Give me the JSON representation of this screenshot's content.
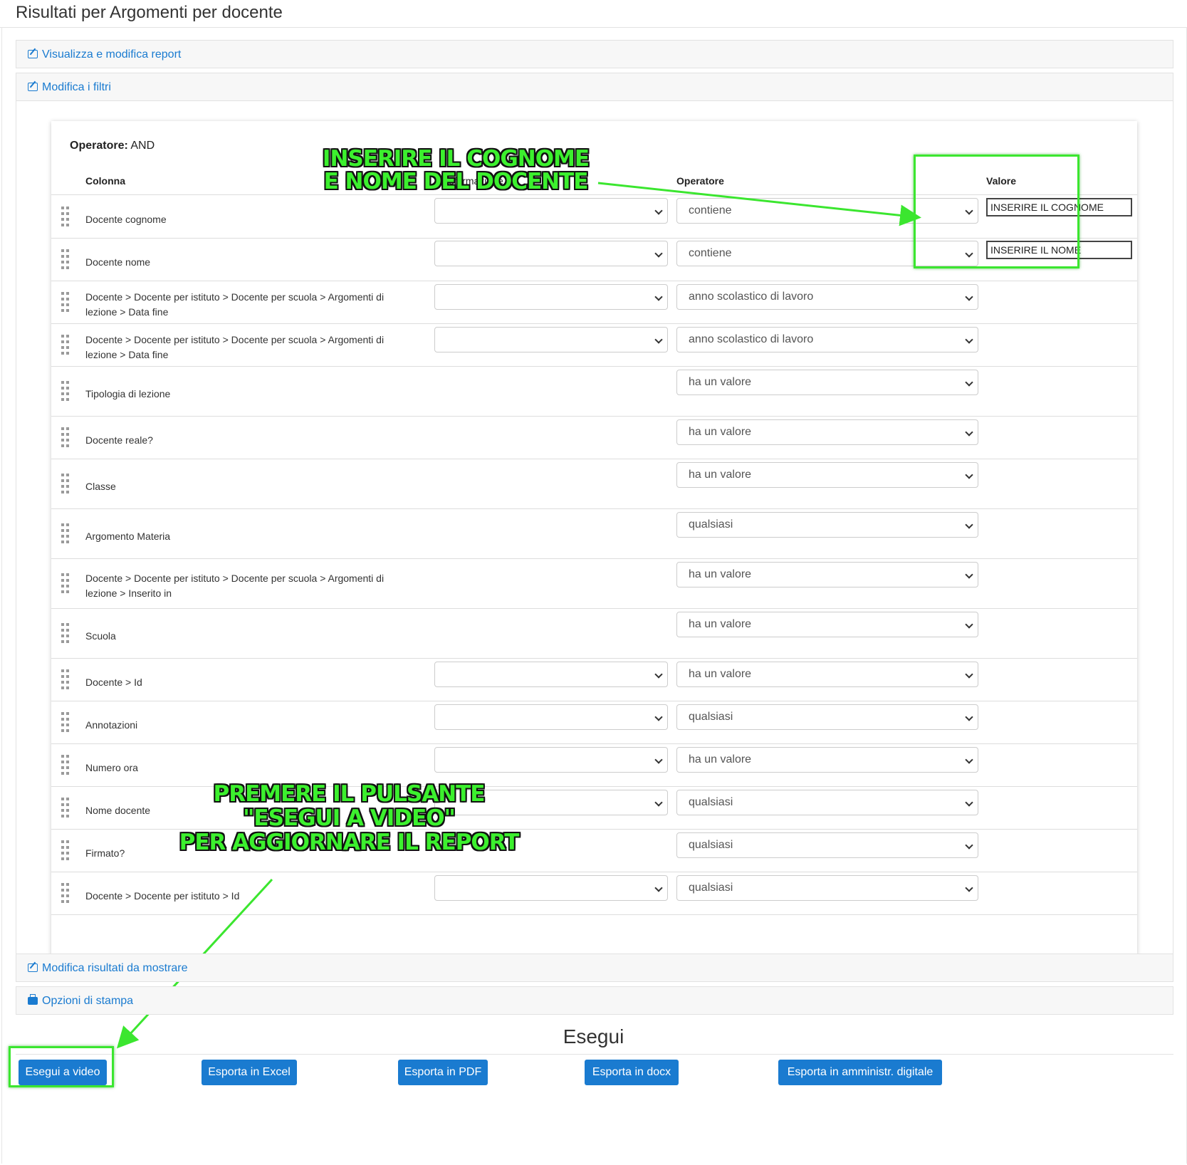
{
  "page": {
    "title": "Risultati per Argomenti per docente"
  },
  "panels": {
    "view_edit": "Visualizza e modifica report",
    "edit_filters": "Modifica i filtri",
    "edit_results": "Modifica risultati da mostrare",
    "print_options": "Opzioni di stampa"
  },
  "filters": {
    "operator_label": "Operatore:",
    "operator_value": "AND",
    "headers": {
      "column": "Colonna",
      "transform": "Trasformazione",
      "operator": "Operatore",
      "value": "Valore"
    },
    "rows": [
      {
        "column": "Docente cognome",
        "operator": "contiene",
        "value": "INSERIRE IL COGNOME"
      },
      {
        "column": "Docente nome",
        "operator": "contiene",
        "value": "INSERIRE IL NOME"
      },
      {
        "column": "Docente > Docente per istituto > Docente per scuola > Argomenti di lezione > Data fine",
        "operator": "anno scolastico di lavoro"
      },
      {
        "column": "Docente > Docente per istituto > Docente per scuola > Argomenti di lezione > Data fine",
        "operator": "anno scolastico di lavoro"
      },
      {
        "column": "Tipologia di lezione",
        "operator": "ha un valore"
      },
      {
        "column": "Docente reale?",
        "operator": "ha un valore"
      },
      {
        "column": "Classe",
        "operator": "ha un valore"
      },
      {
        "column": "Argomento Materia",
        "operator": "qualsiasi"
      },
      {
        "column": "Docente > Docente per istituto > Docente per scuola > Argomenti di lezione > Inserito in",
        "operator": "ha un valore"
      },
      {
        "column": "Scuola",
        "operator": "ha un valore"
      },
      {
        "column": "Docente > Id",
        "operator": "ha un valore"
      },
      {
        "column": "Annotazioni",
        "operator": "qualsiasi"
      },
      {
        "column": "Numero ora",
        "operator": "ha un valore"
      },
      {
        "column": "Nome docente",
        "operator": "qualsiasi"
      },
      {
        "column": "Firmato?",
        "operator": "qualsiasi"
      },
      {
        "column": "Docente > Docente per istituto > Id",
        "operator": "qualsiasi"
      }
    ]
  },
  "annotations": {
    "top_line1": "INSERIRE IL COGNOME",
    "top_line2": "E NOME DEL DOCENTE",
    "bottom_line1": "PREMERE IL PULSANTE",
    "bottom_line2": "\"ESEGUI A VIDEO\"",
    "bottom_line3": "PER AGGIORNARE IL REPORT",
    "color": "#3cf02e"
  },
  "run": {
    "title": "Esegui",
    "buttons": {
      "video": "Esegui a video",
      "excel": "Esporta in Excel",
      "pdf": "Esporta in PDF",
      "docx": "Esporta in docx",
      "digital": "Esporta in amministr. digitale"
    }
  },
  "colors": {
    "link": "#1a7bd0",
    "button": "#1a7bd0",
    "highlight": "#3be62f"
  }
}
